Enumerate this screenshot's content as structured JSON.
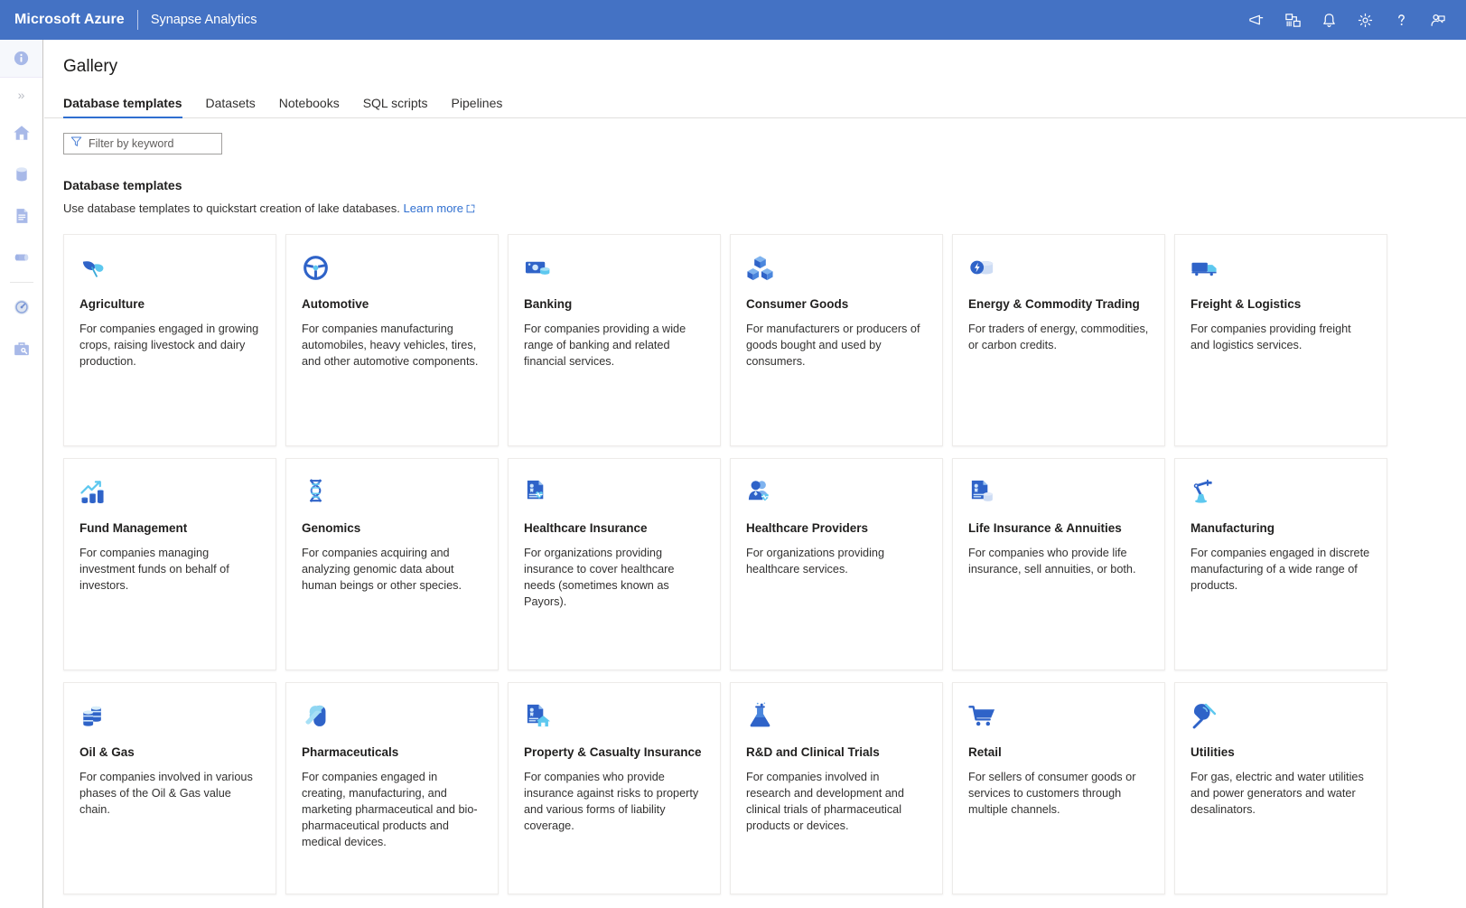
{
  "topbar": {
    "brand": "Microsoft Azure",
    "product": "Synapse Analytics",
    "icons": [
      {
        "name": "feedback-megaphone-icon",
        "label": "Feedback"
      },
      {
        "name": "cloud-shell-icon",
        "label": "Cloud Shell"
      },
      {
        "name": "notifications-bell-icon",
        "label": "Notifications"
      },
      {
        "name": "settings-gear-icon",
        "label": "Settings"
      },
      {
        "name": "help-question-icon",
        "label": "Help"
      },
      {
        "name": "account-feedback-icon",
        "label": "Account"
      }
    ],
    "accent_color": "#4472c4"
  },
  "rail": {
    "items": [
      {
        "name": "info-icon",
        "label": "Info"
      },
      {
        "name": "expand-chevron-icon",
        "label": "Expand"
      },
      {
        "name": "home-icon",
        "label": "Home"
      },
      {
        "name": "data-icon",
        "label": "Data"
      },
      {
        "name": "develop-icon",
        "label": "Develop"
      },
      {
        "name": "integrate-icon",
        "label": "Integrate"
      },
      {
        "name": "monitor-icon",
        "label": "Monitor"
      },
      {
        "name": "manage-icon",
        "label": "Manage"
      }
    ]
  },
  "page": {
    "title": "Gallery"
  },
  "tabs": [
    {
      "label": "Database templates",
      "active": true
    },
    {
      "label": "Datasets",
      "active": false
    },
    {
      "label": "Notebooks",
      "active": false
    },
    {
      "label": "SQL scripts",
      "active": false
    },
    {
      "label": "Pipelines",
      "active": false
    }
  ],
  "filter": {
    "placeholder": "Filter by keyword",
    "value": ""
  },
  "section": {
    "title": "Database templates",
    "description": "Use database templates to quickstart creation of lake databases.",
    "link_label": "Learn more",
    "link_color": "#2f6fd0"
  },
  "cards": [
    {
      "icon": "leaf-icon",
      "title": "Agriculture",
      "description": "For companies engaged in growing crops, raising livestock and dairy production."
    },
    {
      "icon": "steering-wheel-icon",
      "title": "Automotive",
      "description": "For companies manufacturing automobiles, heavy vehicles, tires, and other automotive components."
    },
    {
      "icon": "money-icon",
      "title": "Banking",
      "description": "For companies providing a wide range of banking and related financial services."
    },
    {
      "icon": "boxes-icon",
      "title": "Consumer Goods",
      "description": "For manufacturers or producers of goods bought and used by consumers."
    },
    {
      "icon": "energy-coins-icon",
      "title": "Energy & Commodity Trading",
      "description": "For traders of energy, commodities, or carbon credits."
    },
    {
      "icon": "truck-icon",
      "title": "Freight & Logistics",
      "description": "For companies providing freight and logistics services."
    },
    {
      "icon": "growth-chart-icon",
      "title": "Fund Management",
      "description": "For companies managing investment funds on behalf of investors."
    },
    {
      "icon": "dna-icon",
      "title": "Genomics",
      "description": "For companies acquiring and analyzing genomic data about human beings or other species."
    },
    {
      "icon": "document-heartbeat-icon",
      "title": "Healthcare Insurance",
      "description": "For organizations providing insurance to cover healthcare needs (sometimes known as Payors)."
    },
    {
      "icon": "person-heartbeat-icon",
      "title": "Healthcare Providers",
      "description": "For organizations providing healthcare services."
    },
    {
      "icon": "document-coins-icon",
      "title": "Life Insurance & Annuities",
      "description": "For companies who provide life insurance, sell annuities, or both."
    },
    {
      "icon": "robot-arm-icon",
      "title": "Manufacturing",
      "description": "For companies engaged in discrete manufacturing of a wide range of products."
    },
    {
      "icon": "oil-barrel-icon",
      "title": "Oil & Gas",
      "description": "For companies involved in various phases of the Oil & Gas value chain."
    },
    {
      "icon": "pill-icon",
      "title": "Pharmaceuticals",
      "description": "For companies engaged in creating, manufacturing, and marketing pharmaceutical and bio-pharmaceutical products and medical devices."
    },
    {
      "icon": "document-house-icon",
      "title": "Property & Casualty Insurance",
      "description": "For companies who provide insurance against risks to property and various forms of liability coverage."
    },
    {
      "icon": "flask-icon",
      "title": "R&D and Clinical Trials",
      "description": "For companies involved in research and development and clinical trials of pharmaceutical products or devices."
    },
    {
      "icon": "shopping-cart-icon",
      "title": "Retail",
      "description": "For sellers of consumer goods or services to customers through multiple channels."
    },
    {
      "icon": "power-plug-icon",
      "title": "Utilities",
      "description": "For gas, electric and water utilities and power generators and water desalinators."
    }
  ]
}
